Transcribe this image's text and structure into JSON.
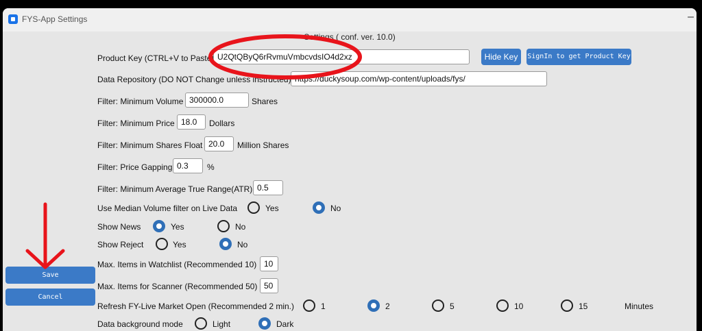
{
  "window": {
    "title": "FYS-App Settings",
    "minimize": "–"
  },
  "heading": "Settings ( conf. ver. 10.0)",
  "product_key": {
    "label": "Product Key (CTRL+V to Paste)",
    "value": "U2QtQByQ6rRvmuVmbcvdsIO4d2xz",
    "hide_label": "Hide Key",
    "signin_label": "SignIn to get Product Key"
  },
  "data_repo": {
    "label": "Data Repository (DO NOT Change unless instructed)",
    "value": "https://duckysoup.com/wp-content/uploads/fys/"
  },
  "min_volume": {
    "label": "Filter: Minimum Volume",
    "value": "300000.0",
    "unit": "Shares"
  },
  "min_price": {
    "label": "Filter: Minimum Price",
    "value": "18.0",
    "unit": "Dollars"
  },
  "min_float": {
    "label": "Filter: Minimum Shares Float",
    "value": "20.0",
    "unit": "Million Shares"
  },
  "price_gap": {
    "label": "Filter: Price Gapping",
    "value": "0.3",
    "unit": "%"
  },
  "min_atr": {
    "label": "Filter: Minimum Average True Range(ATR)",
    "value": "0.5"
  },
  "median_volume": {
    "label": "Use Median Volume filter on Live Data",
    "options": [
      "Yes",
      "No"
    ],
    "selected": "No"
  },
  "show_news": {
    "label": "Show News",
    "options": [
      "Yes",
      "No"
    ],
    "selected": "Yes"
  },
  "show_reject": {
    "label": "Show Reject",
    "options": [
      "Yes",
      "No"
    ],
    "selected": "No"
  },
  "max_watchlist": {
    "label": "Max. Items in Watchlist (Recommended 10)",
    "value": "10"
  },
  "max_scanner": {
    "label": "Max. Items for Scanner (Recommended 50)",
    "value": "50"
  },
  "refresh": {
    "label": "Refresh FY-Live Market Open (Recommended 2 min.)",
    "options": [
      "1",
      "2",
      "5",
      "10",
      "15"
    ],
    "selected": "2",
    "unit": "Minutes"
  },
  "bg_mode": {
    "label": "Data background mode",
    "options": [
      "Light",
      "Dark"
    ],
    "selected": "Dark"
  },
  "actions": {
    "save": "Save",
    "cancel": "Cancel"
  },
  "colors": {
    "accent": "#3b7ac7",
    "annotation": "#e8141b",
    "radio_selected": "#2f6fb7"
  }
}
